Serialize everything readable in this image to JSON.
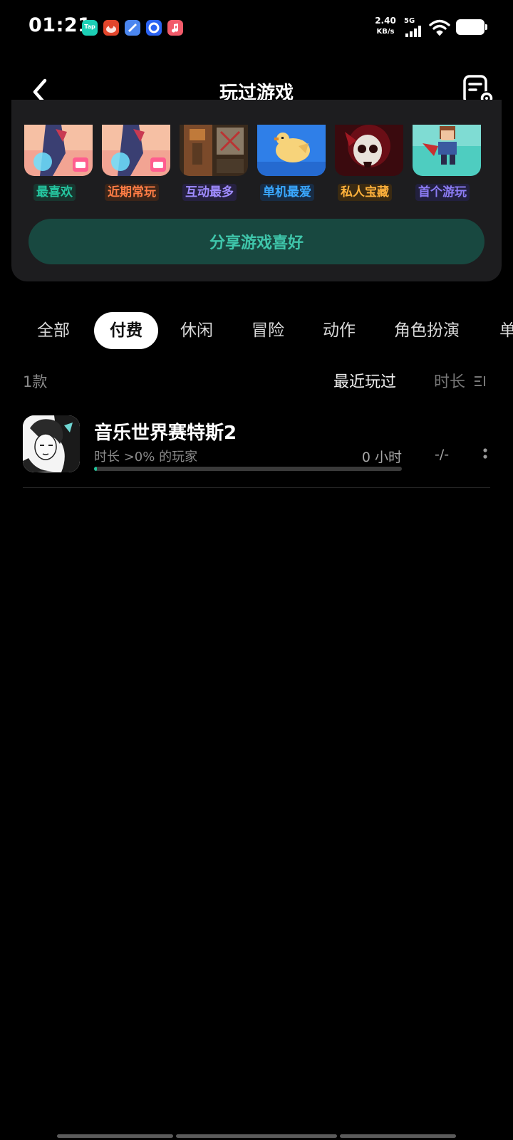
{
  "status_bar": {
    "time": "01:21",
    "net_speed_value": "2.40",
    "net_speed_unit": "KB/s",
    "network_type": "5G",
    "notification_icons": [
      {
        "name": "taptap-app-icon",
        "label": "Tap",
        "color": "#1ccfb5"
      },
      {
        "name": "red-app-icon",
        "label": "",
        "color": "#e2452b"
      },
      {
        "name": "blue-app-icon",
        "label": "",
        "color": "#4b86ef"
      },
      {
        "name": "compass-app-icon",
        "label": "",
        "color": "#2b63f2"
      },
      {
        "name": "music-app-icon",
        "label": "",
        "color": "#f25b6a"
      }
    ]
  },
  "header": {
    "title": "玩过游戏"
  },
  "preference_cards": [
    {
      "label": "最喜欢",
      "color": "#25c6a0"
    },
    {
      "label": "近期常玩",
      "color": "#ff7d45"
    },
    {
      "label": "互动最多",
      "color": "#a08cff"
    },
    {
      "label": "单机最爱",
      "color": "#3aa8ff"
    },
    {
      "label": "私人宝藏",
      "color": "#ffb23c"
    },
    {
      "label": "首个游玩",
      "color": "#8c7cf4"
    }
  ],
  "share_button": "分享游戏喜好",
  "tabs": [
    {
      "label": "全部",
      "active": false
    },
    {
      "label": "付费",
      "active": true
    },
    {
      "label": "休闲",
      "active": false
    },
    {
      "label": "冒险",
      "active": false
    },
    {
      "label": "动作",
      "active": false
    },
    {
      "label": "角色扮演",
      "active": false
    },
    {
      "label": "单",
      "active": false
    }
  ],
  "list": {
    "count": "1款",
    "sort_recent": "最近玩过",
    "sort_duration": "时长",
    "games": [
      {
        "title": "音乐世界赛特斯2",
        "stat": "时长 >0% 的玩家",
        "hours": "0 小时",
        "rating": "-/-",
        "progress": 0.01
      }
    ]
  },
  "colors": {
    "accent": "#20c49a",
    "card_bg": "#1d1d1f",
    "share_bg": "#184840"
  }
}
